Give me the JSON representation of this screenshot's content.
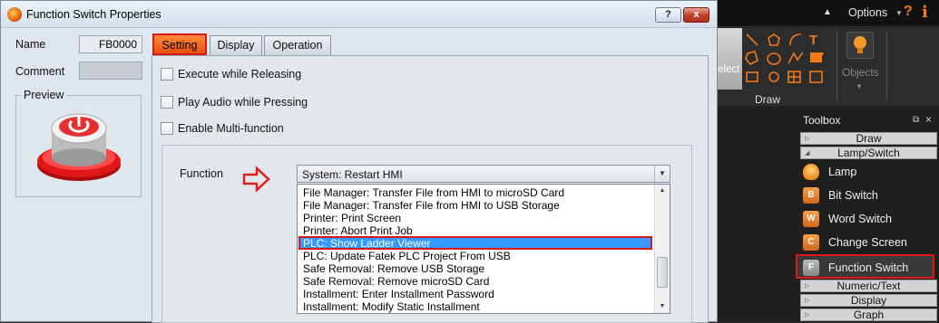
{
  "window": {
    "title": "Function Switch Properties",
    "help_label": "?",
    "close_label": "x"
  },
  "form": {
    "name_label": "Name",
    "name_value": "FB0000",
    "comment_label": "Comment",
    "comment_value": "",
    "preview_label": "Preview"
  },
  "tabs": [
    {
      "label": "Setting",
      "active": true
    },
    {
      "label": "Display",
      "active": false
    },
    {
      "label": "Operation",
      "active": false
    }
  ],
  "settings": {
    "execute_while_releasing": "Execute while Releasing",
    "play_audio_while_pressing": "Play Audio while Pressing",
    "enable_multi_function": "Enable Multi-function"
  },
  "function": {
    "label": "Function",
    "selected": "System: Restart HMI",
    "options": [
      "File Manager: Transfer File from HMI to microSD Card",
      "File Manager: Transfer File from HMI to USB Storage",
      "Printer: Print Screen",
      "Printer: Abort Print Job",
      "PLC: Show Ladder Viewer",
      "PLC: Update Fatek PLC Project From USB",
      "Safe Removal: Remove USB Storage",
      "Safe Removal: Remove microSD Card",
      "Installment: Enter Installment Password",
      "Installment: Modify Static Installment"
    ],
    "highlighted_index": 4
  },
  "right_panel": {
    "options_label": "Options",
    "help_icon": "?",
    "info_icon": "i",
    "select_label": "elect",
    "draw_label": "Draw",
    "objects_label": "Objects",
    "toolbox_title": "Toolbox",
    "categories": {
      "draw": "Draw",
      "lamp_switch": "Lamp/Switch",
      "numeric_text": "Numeric/Text",
      "display": "Display",
      "graph": "Graph"
    },
    "tools": [
      {
        "label": "Lamp",
        "icon_letter": ""
      },
      {
        "label": "Bit Switch",
        "icon_letter": "B"
      },
      {
        "label": "Word Switch",
        "icon_letter": "W"
      },
      {
        "label": "Change Screen",
        "icon_letter": "C"
      },
      {
        "label": "Function Switch",
        "icon_letter": "F"
      }
    ],
    "accent_color": "#f07a1a"
  }
}
